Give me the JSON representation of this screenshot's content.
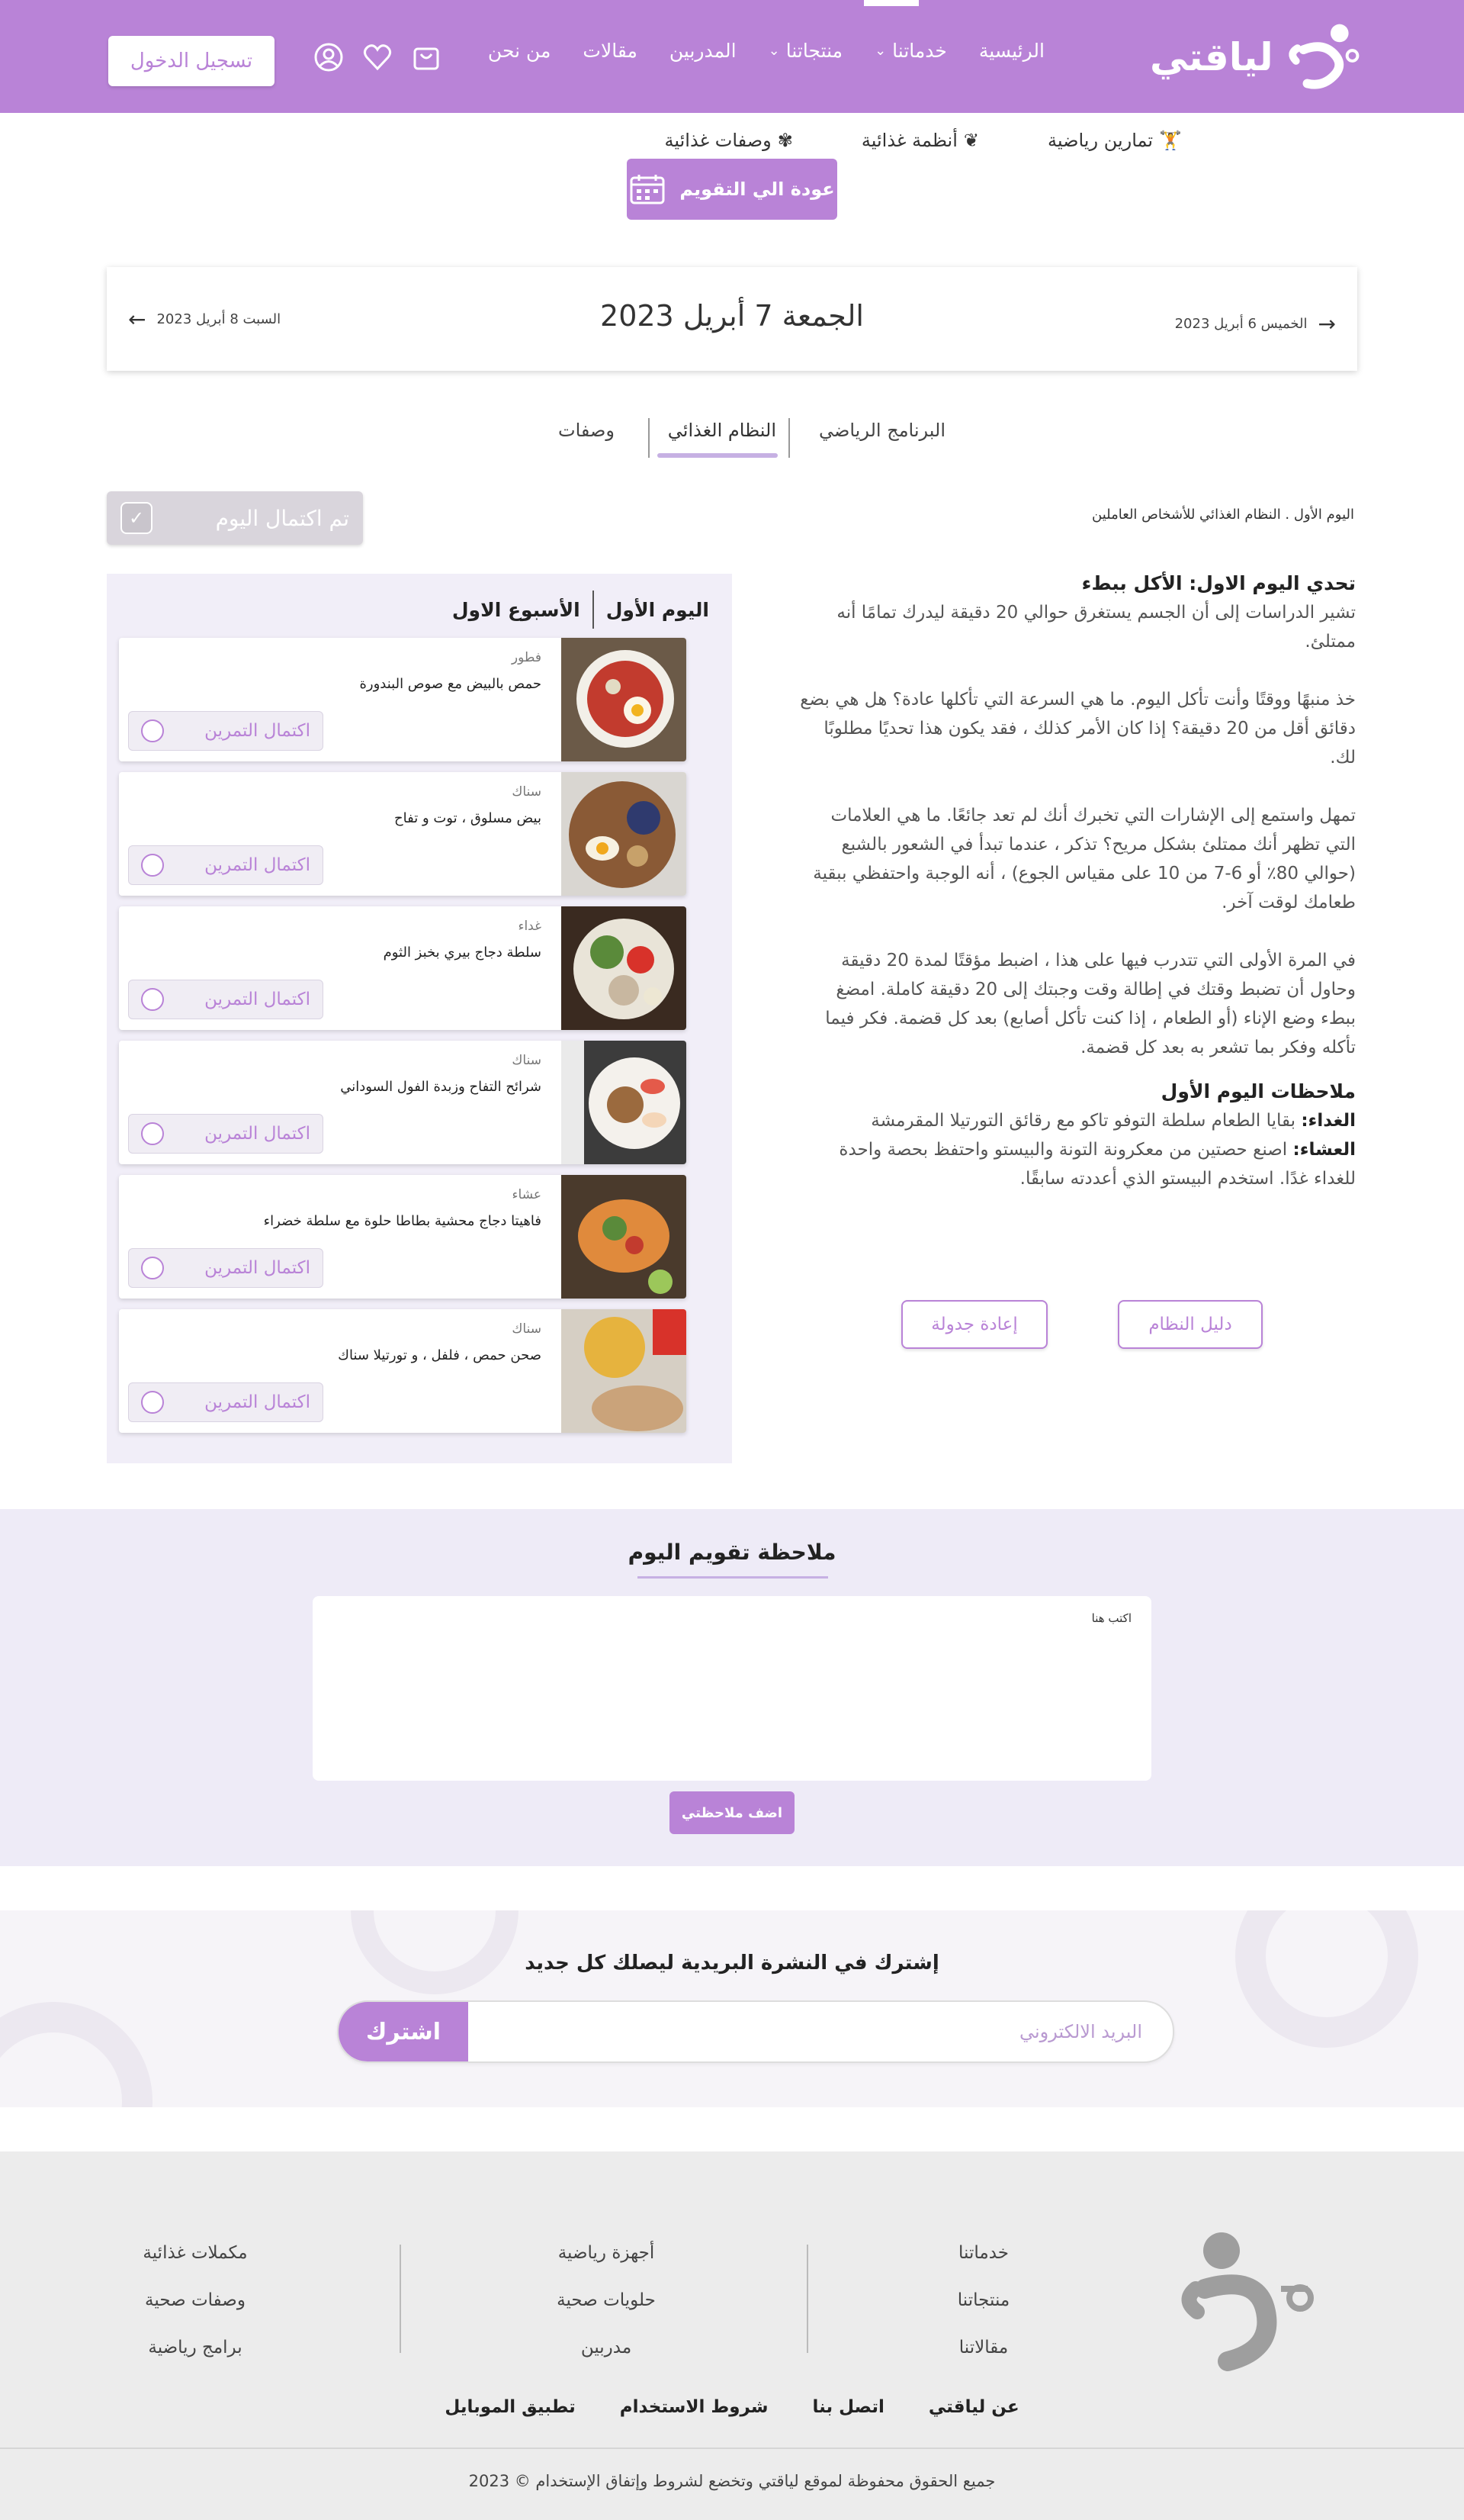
{
  "brand": {
    "name": "لياقتي",
    "accent": "#b983d7"
  },
  "header": {
    "nav": [
      {
        "label": "الرئيسية",
        "dropdown": false
      },
      {
        "label": "خدماتنا",
        "dropdown": true
      },
      {
        "label": "منتجاتنا",
        "dropdown": true
      },
      {
        "label": "المدربين",
        "dropdown": false
      },
      {
        "label": "مقالات",
        "dropdown": false
      },
      {
        "label": "من نحن",
        "dropdown": false
      }
    ],
    "icons": [
      "user-icon",
      "heart-icon",
      "cart-icon"
    ],
    "login_label": "تسجيل الدخول"
  },
  "subnav": {
    "items": [
      {
        "label": "تمارين رياضية",
        "icon": "dumbbell-icon"
      },
      {
        "label": "أنظمة غذائية",
        "icon": "leaf-icon"
      },
      {
        "label": "وصفات غذائية",
        "icon": "recipe-icon"
      }
    ],
    "back_label": "عودة الي التقويم"
  },
  "date_nav": {
    "current": "الجمعة 7 أبريل 2023",
    "next": "الخميس 6 أبريل 2023",
    "prev": "السبت 8 أبريل 2023"
  },
  "tabs": [
    {
      "label": "البرنامج الرياضي",
      "active": false
    },
    {
      "label": "النظام الغذائي",
      "active": true
    },
    {
      "label": "وصفات",
      "active": false
    }
  ],
  "day": {
    "subtitle": "اليوم الأول . النظام الغذائي للأشخاص العاملين",
    "complete_label": "تم اكتمال اليوم"
  },
  "article": {
    "challenge_title": "تحدي اليوم الاول: الأكل ببطء",
    "p1": "تشير الدراسات إلى أن الجسم يستغرق حوالي 20 دقيقة ليدرك تمامًا أنه ممتلئ.",
    "p2": "خذ منبهًا ووقتًا وأنت تأكل اليوم. ما هي السرعة التي تأكلها عادة؟ هل هي بضع دقائق أقل من 20 دقيقة؟ إذا كان الأمر كذلك ، فقد يكون هذا تحديًا مطلوبًا لك.",
    "p3": "تمهل واستمع إلى الإشارات التي تخبرك أنك لم تعد جائعًا. ما هي العلامات التي تظهر أنك ممتلئ بشكل مريح؟ تذكر ، عندما تبدأ في الشعور بالشبع (حوالي 80٪ أو 6-7 من 10 على مقياس الجوع) ، أنه الوجبة واحتفظي ببقية طعامك لوقت آخر.",
    "p4": "في المرة الأولى التي تتدرب فيها على هذا ، اضبط مؤقتًا لمدة 20 دقيقة وحاول أن تضبط وقتك في إطالة وقت وجبتك إلى 20 دقيقة كاملة. امضغ ببطء وضع الإناء (أو الطعام ، إذا كنت تأكل أصابع) بعد كل قضمة. فكر فيما تأكله وفكر بما تشعر به بعد كل قضمة.",
    "notes_title": "ملاحظات اليوم الأول",
    "lunch_label": "الغداء:",
    "lunch_text": "بقايا الطعام سلطة التوفو تاكو مع رقائق التورتيلا المقرمشة",
    "dinner_label": "العشاء:",
    "dinner_text": "اصنع حصتين من معكرونة التونة والبيستو واحتفظ بحصة واحدة للغداء غدًا. استخدم البيستو الذي أعددته سابقًا."
  },
  "actions": {
    "guide_label": "دليل النظام",
    "reschedule_label": "إعادة جدولة"
  },
  "meals": {
    "day_label": "اليوم الأول",
    "week_label": "الأسبوع الاول",
    "complete_label": "اكتمال التمرين",
    "items": [
      {
        "category": "فطور",
        "name": "حمص بالبيض مع صوص البندورة",
        "img": "shakshuka"
      },
      {
        "category": "سناك",
        "name": "بيض مسلوق ، توت و تفاح",
        "img": "eggs-berries"
      },
      {
        "category": "غداء",
        "name": "سلطة دجاج بيري بخبز الثوم",
        "img": "salad"
      },
      {
        "category": "سناك",
        "name": "شرائح التفاح وزبدة الفول السوداني",
        "img": "apple-pb"
      },
      {
        "category": "عشاء",
        "name": "فاهيتا دجاج محشية بطاطا حلوة مع سلطة خضراء",
        "img": "fajita"
      },
      {
        "category": "سناك",
        "name": "صحن حمص ، فلفل ، و تورتيلا سناك",
        "img": "hummus"
      }
    ]
  },
  "note": {
    "title": "ملاحظة تقويم اليوم",
    "placeholder": "اكتب هنا",
    "button": "اضف ملاحظتي"
  },
  "newsletter": {
    "title": "إشترك في النشرة البريدية ليصلك كل جديد",
    "placeholder": "البريد الالكتروني",
    "button": "اشترك"
  },
  "footer": {
    "col1": [
      "خدماتنا",
      "منتجاتنا",
      "مقالاتنا"
    ],
    "col2": [
      "أجهزة رياضية",
      "حلويات صحية",
      "مدربين"
    ],
    "col3": [
      "مكملات غذائية",
      "وصفات صحية",
      "برامج رياضية"
    ],
    "links": [
      "عن لياقتي",
      "اتصل بنا",
      "شروط الاستخدام",
      "تطبيق الموبايل"
    ],
    "copyright": "جميع الحقوق محفوظة لموقع لياقتي وتخضع لشروط وإتفاق الإستخدام © 2023"
  }
}
